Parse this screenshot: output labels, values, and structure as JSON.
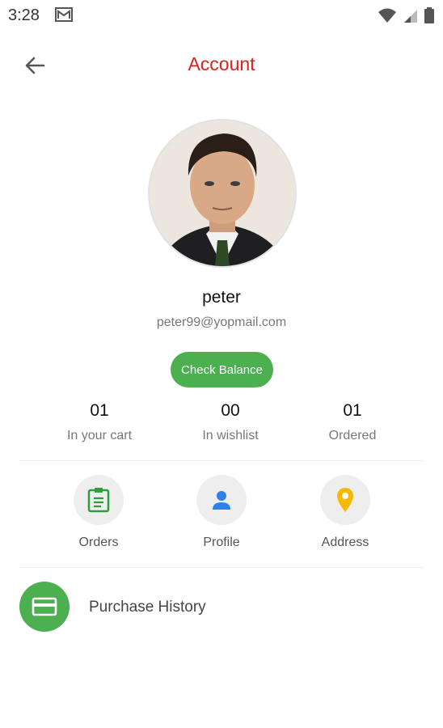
{
  "status": {
    "time": "3:28",
    "icons": [
      "mail-icon",
      "wifi-icon",
      "signal-icon",
      "battery-icon"
    ]
  },
  "header": {
    "title": "Account",
    "back_icon": "arrow-left-icon",
    "title_color": "#e31d1d"
  },
  "profile": {
    "name": "peter",
    "email": "peter99@yopmail.com",
    "avatar": "profile-photo"
  },
  "balance_button": {
    "label": "Check Balance",
    "color": "#4caf50"
  },
  "stats": [
    {
      "value": "01",
      "label": "In your cart"
    },
    {
      "value": "00",
      "label": "In wishlist"
    },
    {
      "value": "01",
      "label": "Ordered"
    }
  ],
  "actions": [
    {
      "label": "Orders",
      "icon": "clipboard-icon",
      "color": "#2e9d3a"
    },
    {
      "label": "Profile",
      "icon": "person-icon",
      "color": "#2f80ed"
    },
    {
      "label": "Address",
      "icon": "location-pin-icon",
      "color": "#f6b900"
    }
  ],
  "purchase_history": {
    "label": "Purchase History",
    "icon": "credit-card-icon"
  }
}
